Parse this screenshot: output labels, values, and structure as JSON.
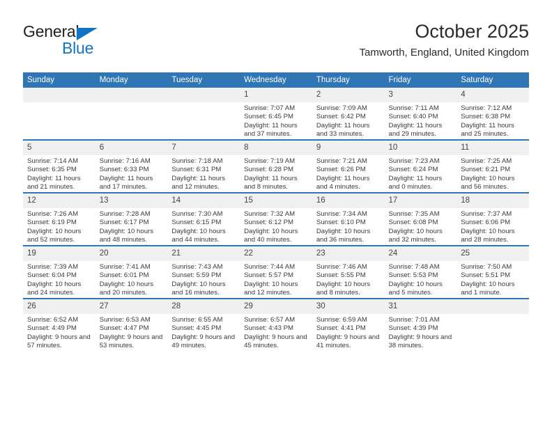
{
  "brand": {
    "name_top": "General",
    "name_bottom": "Blue",
    "accent_color": "#1273c4",
    "triangle_icon": "triangle-icon"
  },
  "header": {
    "title": "October 2025",
    "subtitle": "Tamworth, England, United Kingdom"
  },
  "calendar": {
    "header_bg": "#3075b4",
    "daynum_bg": "#f0f0f0",
    "weekdays": [
      "Sunday",
      "Monday",
      "Tuesday",
      "Wednesday",
      "Thursday",
      "Friday",
      "Saturday"
    ],
    "weeks": [
      [
        {
          "day": "",
          "empty": true
        },
        {
          "day": "",
          "empty": true
        },
        {
          "day": "",
          "empty": true
        },
        {
          "day": "1",
          "sunrise": "Sunrise: 7:07 AM",
          "sunset": "Sunset: 6:45 PM",
          "daylight": "Daylight: 11 hours and 37 minutes."
        },
        {
          "day": "2",
          "sunrise": "Sunrise: 7:09 AM",
          "sunset": "Sunset: 6:42 PM",
          "daylight": "Daylight: 11 hours and 33 minutes."
        },
        {
          "day": "3",
          "sunrise": "Sunrise: 7:11 AM",
          "sunset": "Sunset: 6:40 PM",
          "daylight": "Daylight: 11 hours and 29 minutes."
        },
        {
          "day": "4",
          "sunrise": "Sunrise: 7:12 AM",
          "sunset": "Sunset: 6:38 PM",
          "daylight": "Daylight: 11 hours and 25 minutes."
        }
      ],
      [
        {
          "day": "5",
          "sunrise": "Sunrise: 7:14 AM",
          "sunset": "Sunset: 6:35 PM",
          "daylight": "Daylight: 11 hours and 21 minutes."
        },
        {
          "day": "6",
          "sunrise": "Sunrise: 7:16 AM",
          "sunset": "Sunset: 6:33 PM",
          "daylight": "Daylight: 11 hours and 17 minutes."
        },
        {
          "day": "7",
          "sunrise": "Sunrise: 7:18 AM",
          "sunset": "Sunset: 6:31 PM",
          "daylight": "Daylight: 11 hours and 12 minutes."
        },
        {
          "day": "8",
          "sunrise": "Sunrise: 7:19 AM",
          "sunset": "Sunset: 6:28 PM",
          "daylight": "Daylight: 11 hours and 8 minutes."
        },
        {
          "day": "9",
          "sunrise": "Sunrise: 7:21 AM",
          "sunset": "Sunset: 6:26 PM",
          "daylight": "Daylight: 11 hours and 4 minutes."
        },
        {
          "day": "10",
          "sunrise": "Sunrise: 7:23 AM",
          "sunset": "Sunset: 6:24 PM",
          "daylight": "Daylight: 11 hours and 0 minutes."
        },
        {
          "day": "11",
          "sunrise": "Sunrise: 7:25 AM",
          "sunset": "Sunset: 6:21 PM",
          "daylight": "Daylight: 10 hours and 56 minutes."
        }
      ],
      [
        {
          "day": "12",
          "sunrise": "Sunrise: 7:26 AM",
          "sunset": "Sunset: 6:19 PM",
          "daylight": "Daylight: 10 hours and 52 minutes."
        },
        {
          "day": "13",
          "sunrise": "Sunrise: 7:28 AM",
          "sunset": "Sunset: 6:17 PM",
          "daylight": "Daylight: 10 hours and 48 minutes."
        },
        {
          "day": "14",
          "sunrise": "Sunrise: 7:30 AM",
          "sunset": "Sunset: 6:15 PM",
          "daylight": "Daylight: 10 hours and 44 minutes."
        },
        {
          "day": "15",
          "sunrise": "Sunrise: 7:32 AM",
          "sunset": "Sunset: 6:12 PM",
          "daylight": "Daylight: 10 hours and 40 minutes."
        },
        {
          "day": "16",
          "sunrise": "Sunrise: 7:34 AM",
          "sunset": "Sunset: 6:10 PM",
          "daylight": "Daylight: 10 hours and 36 minutes."
        },
        {
          "day": "17",
          "sunrise": "Sunrise: 7:35 AM",
          "sunset": "Sunset: 6:08 PM",
          "daylight": "Daylight: 10 hours and 32 minutes."
        },
        {
          "day": "18",
          "sunrise": "Sunrise: 7:37 AM",
          "sunset": "Sunset: 6:06 PM",
          "daylight": "Daylight: 10 hours and 28 minutes."
        }
      ],
      [
        {
          "day": "19",
          "sunrise": "Sunrise: 7:39 AM",
          "sunset": "Sunset: 6:04 PM",
          "daylight": "Daylight: 10 hours and 24 minutes."
        },
        {
          "day": "20",
          "sunrise": "Sunrise: 7:41 AM",
          "sunset": "Sunset: 6:01 PM",
          "daylight": "Daylight: 10 hours and 20 minutes."
        },
        {
          "day": "21",
          "sunrise": "Sunrise: 7:43 AM",
          "sunset": "Sunset: 5:59 PM",
          "daylight": "Daylight: 10 hours and 16 minutes."
        },
        {
          "day": "22",
          "sunrise": "Sunrise: 7:44 AM",
          "sunset": "Sunset: 5:57 PM",
          "daylight": "Daylight: 10 hours and 12 minutes."
        },
        {
          "day": "23",
          "sunrise": "Sunrise: 7:46 AM",
          "sunset": "Sunset: 5:55 PM",
          "daylight": "Daylight: 10 hours and 8 minutes."
        },
        {
          "day": "24",
          "sunrise": "Sunrise: 7:48 AM",
          "sunset": "Sunset: 5:53 PM",
          "daylight": "Daylight: 10 hours and 5 minutes."
        },
        {
          "day": "25",
          "sunrise": "Sunrise: 7:50 AM",
          "sunset": "Sunset: 5:51 PM",
          "daylight": "Daylight: 10 hours and 1 minute."
        }
      ],
      [
        {
          "day": "26",
          "sunrise": "Sunrise: 6:52 AM",
          "sunset": "Sunset: 4:49 PM",
          "daylight": "Daylight: 9 hours and 57 minutes."
        },
        {
          "day": "27",
          "sunrise": "Sunrise: 6:53 AM",
          "sunset": "Sunset: 4:47 PM",
          "daylight": "Daylight: 9 hours and 53 minutes."
        },
        {
          "day": "28",
          "sunrise": "Sunrise: 6:55 AM",
          "sunset": "Sunset: 4:45 PM",
          "daylight": "Daylight: 9 hours and 49 minutes."
        },
        {
          "day": "29",
          "sunrise": "Sunrise: 6:57 AM",
          "sunset": "Sunset: 4:43 PM",
          "daylight": "Daylight: 9 hours and 45 minutes."
        },
        {
          "day": "30",
          "sunrise": "Sunrise: 6:59 AM",
          "sunset": "Sunset: 4:41 PM",
          "daylight": "Daylight: 9 hours and 41 minutes."
        },
        {
          "day": "31",
          "sunrise": "Sunrise: 7:01 AM",
          "sunset": "Sunset: 4:39 PM",
          "daylight": "Daylight: 9 hours and 38 minutes."
        },
        {
          "day": "",
          "empty": true
        }
      ]
    ]
  }
}
